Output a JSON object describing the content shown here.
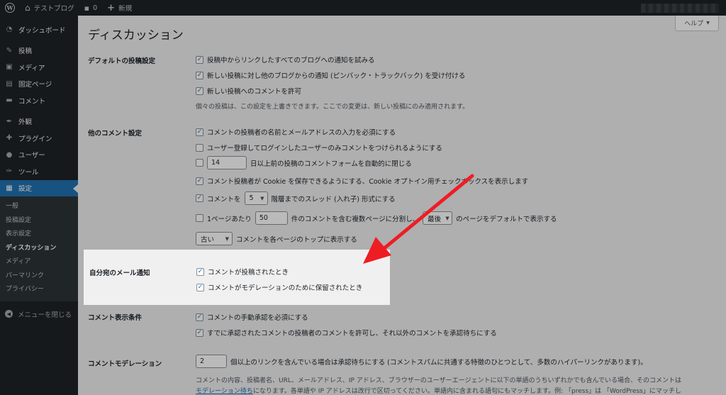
{
  "adminbar": {
    "wp_logo": "W",
    "home_icon": "⌂",
    "site_name": "テストブログ",
    "comments_icon": "▪",
    "comments_count": "0",
    "new_icon": "+",
    "new_label": "新規"
  },
  "sidebar": {
    "items": [
      {
        "icon": "◔",
        "label": "ダッシュボード"
      },
      {
        "icon": "✎",
        "label": "投稿"
      },
      {
        "icon": "▣",
        "label": "メディア"
      },
      {
        "icon": "▤",
        "label": "固定ページ"
      },
      {
        "icon": "▬",
        "label": "コメント"
      },
      {
        "icon": "✒",
        "label": "外観"
      },
      {
        "icon": "✚",
        "label": "プラグイン"
      },
      {
        "icon": "●",
        "label": "ユーザー"
      },
      {
        "icon": "✑",
        "label": "ツール"
      },
      {
        "icon": "▦",
        "label": "設定"
      }
    ],
    "submenu": [
      "一般",
      "投稿設定",
      "表示設定",
      "ディスカッション",
      "メディア",
      "パーマリンク",
      "プライバシー"
    ],
    "collapse_icon": "◀",
    "collapse_label": "メニューを閉じる"
  },
  "help": {
    "label": "ヘルプ",
    "chevron": "▼"
  },
  "page_title": "ディスカッション",
  "default_post": {
    "label": "デフォルトの投稿設定",
    "opt1": "投稿中からリンクしたすべてのブログへの通知を試みる",
    "opt2": "新しい投稿に対し他のブログからの通知 (ピンバック・トラックバック) を受け付ける",
    "opt3": "新しい投稿へのコメントを許可",
    "desc": "個々の投稿は、この設定を上書きできます。ここでの変更は、新しい投稿にのみ適用されます。"
  },
  "other_comments": {
    "label": "他のコメント設定",
    "opt1": "コメントの投稿者の名前とメールアドレスの入力を必須にする",
    "opt2": "ユーザー登録してログインしたユーザーのみコメントをつけられるようにする",
    "close_days": "14",
    "close_text": "日以上前の投稿のコメントフォームを自動的に閉じる",
    "opt4": "コメント投稿者が Cookie を保存できるようにする、Cookie オプトイン用チェックボックスを表示します",
    "thread_pre": "コメントを",
    "thread_depth": "5",
    "thread_post": "階層までのスレッド (入れ子) 形式にする",
    "page_pre": "1ページあたり",
    "page_count": "50",
    "page_mid": "件のコメントを含む複数ページに分割し、",
    "page_which": "最後",
    "page_post": "のページをデフォルトで表示する",
    "order_sel": "古い",
    "order_text": "コメントを各ページのトップに表示する"
  },
  "email_me": {
    "label": "自分宛のメール通知",
    "opt1": "コメントが投稿されたとき",
    "opt2": "コメントがモデレーションのために保留されたとき"
  },
  "appear": {
    "label": "コメント表示条件",
    "opt1": "コメントの手動承認を必須にする",
    "opt2": "すでに承認されたコメントの投稿者のコメントを許可し、それ以外のコメントを承認待ちにする"
  },
  "moderation": {
    "label": "コメントモデレーション",
    "links": "2",
    "links_text": "個以上のリンクを含んでいる場合は承認待ちにする (コメントスパムに共通する特徴のひとつとして、多数のハイパーリンクがあります)。",
    "desc1": "コメントの内容、投稿者名、URL、メールアドレス、IP アドレス、ブラウザーのユーザーエージェントに以下の単語のうちいずれかでも含んでいる場合、そのコメントは",
    "desc2_link": "モデレーション待ち",
    "desc2_text": "になります。各単語や IP アドレスは改行で区切ってください。単語内に含まれる語句にもマッチします。例: 「press」は 「WordPress」にマッチし"
  },
  "colors": {
    "sidebar": "#1d2327",
    "accent": "#2271b1",
    "arrow": "#ee1d23"
  }
}
